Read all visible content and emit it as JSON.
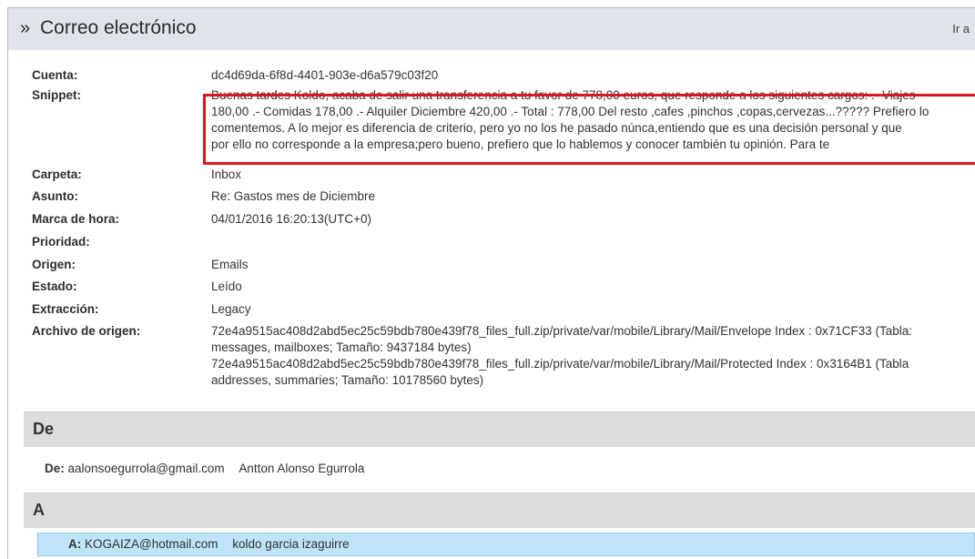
{
  "header": {
    "chevron": "»",
    "title": "Correo electrónico",
    "goto_label": "Ir a"
  },
  "fields": [
    {
      "label": "Cuenta:",
      "value": [
        "dc4d69da-6f8d-4401-903e-d6a579c03f20"
      ]
    },
    {
      "label": "Snippet:",
      "value": [
        "Buenas tardes Koldo, acaba de salir una transferencia a tu favor de 778,00 euros, que responde a los siguientes cargos: .- Viajes",
        "180,00 .- Comidas 178,00 .- Alquiler Diciembre 420,00 .- Total : 778,00 Del resto ,cafes ,pinchos ,copas,cervezas...????? Prefiero lo",
        "comentemos. A lo mejor es diferencia de criterio, pero yo no los he pasado núnca,entiendo que es una decisión personal y que",
        "por ello no corresponde a la empresa;pero bueno, prefiero que lo hablemos y conocer también tu opinión. Para te"
      ]
    },
    {
      "label": "Carpeta:",
      "value": [
        "Inbox"
      ]
    },
    {
      "label": "Asunto:",
      "value": [
        "Re: Gastos mes de Diciembre"
      ]
    },
    {
      "label": "Marca de hora:",
      "value": [
        "04/01/2016 16:20:13(UTC+0)"
      ]
    },
    {
      "label": "Prioridad:",
      "value": [
        ""
      ]
    },
    {
      "label": "Origen:",
      "value": [
        "Emails"
      ]
    },
    {
      "label": "Estado:",
      "value": [
        "Leído"
      ]
    },
    {
      "label": "Extracción:",
      "value": [
        "Legacy"
      ]
    },
    {
      "label": "Archivo de origen:",
      "value": [
        "72e4a9515ac408d2abd5ec25c59bdb780e439f78_files_full.zip/private/var/mobile/Library/Mail/Envelope Index : 0x71CF33 (Tabla:",
        "messages, mailboxes; Tamaño: 9437184 bytes)",
        "72e4a9515ac408d2abd5ec25c59bdb780e439f78_files_full.zip/private/var/mobile/Library/Mail/Protected Index : 0x3164B1 (Tabla",
        "addresses, summaries; Tamaño: 10178560 bytes)"
      ]
    }
  ],
  "from_section": {
    "title": "De",
    "label": "De:",
    "email": "aalonsoegurrola@gmail.com",
    "name": "Antton Alonso Egurrola"
  },
  "to_section": {
    "title": "A",
    "label": "A:",
    "email": "KOGAIZA@hotmail.com",
    "name": "koldo garcia izaguirre"
  },
  "colors": {
    "highlight_border": "#e0141e",
    "selected_row": "#bfe4f7"
  }
}
